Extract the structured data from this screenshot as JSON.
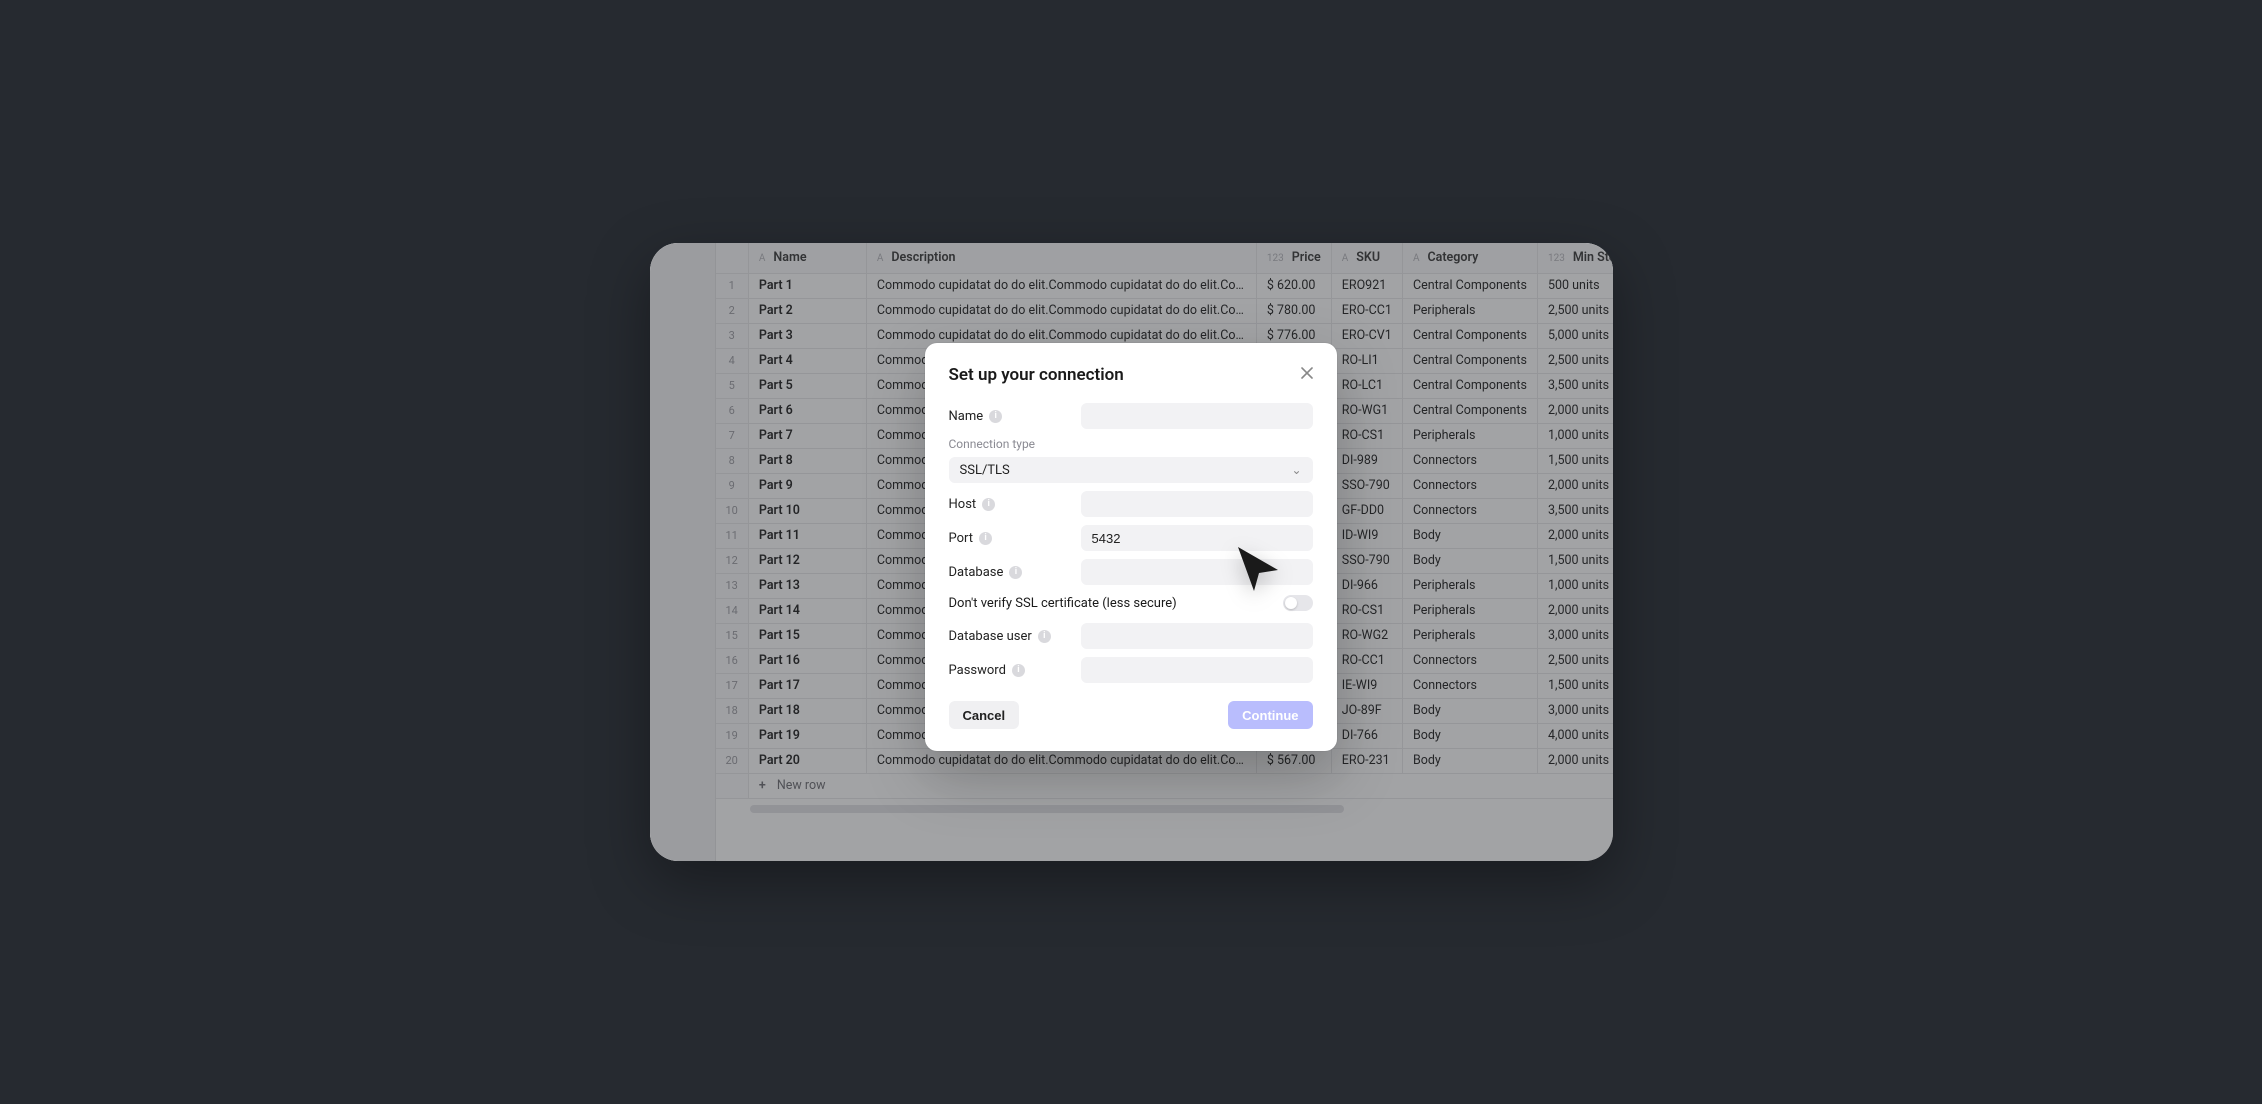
{
  "columns": [
    {
      "icon": "A",
      "label": "Name"
    },
    {
      "icon": "A",
      "label": "Description"
    },
    {
      "icon": "123",
      "label": "Price"
    },
    {
      "icon": "A",
      "label": "SKU"
    },
    {
      "icon": "A",
      "label": "Category"
    },
    {
      "icon": "123",
      "label": "Min Stock Level"
    }
  ],
  "description_filler": "Commodo cupidatat do do elit.Commodo cupidatat do do elit.Commodo cupidat",
  "rows": [
    {
      "name": "Part 1",
      "price": "$ 620.00",
      "sku": "ERO921",
      "cat": "Central Components",
      "stock": "500 units"
    },
    {
      "name": "Part 2",
      "price": "$ 780.00",
      "sku": "ERO-CC1",
      "cat": "Peripherals",
      "stock": "2,500 units"
    },
    {
      "name": "Part 3",
      "price": "$ 776.00",
      "sku": "ERO-CV1",
      "cat": "Central Components",
      "stock": "5,000 units"
    },
    {
      "name": "Part 4",
      "price": "",
      "sku": "RO-LI1",
      "cat": "Central Components",
      "stock": "2,500 units"
    },
    {
      "name": "Part 5",
      "price": "",
      "sku": "RO-LC1",
      "cat": "Central Components",
      "stock": "3,500 units"
    },
    {
      "name": "Part 6",
      "price": "",
      "sku": "RO-WG1",
      "cat": "Central Components",
      "stock": "2,000 units"
    },
    {
      "name": "Part 7",
      "price": "",
      "sku": "RO-CS1",
      "cat": "Peripherals",
      "stock": "1,000 units"
    },
    {
      "name": "Part 8",
      "price": "",
      "sku": "DI-989",
      "cat": "Connectors",
      "stock": "1,500 units"
    },
    {
      "name": "Part 9",
      "price": "",
      "sku": "SSO-790",
      "cat": "Connectors",
      "stock": "2,000 units"
    },
    {
      "name": "Part 10",
      "price": "",
      "sku": "GF-DD0",
      "cat": "Connectors",
      "stock": "3,500 units"
    },
    {
      "name": "Part 11",
      "price": "",
      "sku": "ID-WI9",
      "cat": "Body",
      "stock": "2,000 units"
    },
    {
      "name": "Part 12",
      "price": "",
      "sku": "SSO-790",
      "cat": "Body",
      "stock": "1,500 units"
    },
    {
      "name": "Part 13",
      "price": "",
      "sku": "DI-966",
      "cat": "Peripherals",
      "stock": "1,000 units"
    },
    {
      "name": "Part 14",
      "price": "",
      "sku": "RO-CS1",
      "cat": "Peripherals",
      "stock": "2,000 units"
    },
    {
      "name": "Part 15",
      "price": "",
      "sku": "RO-WG2",
      "cat": "Peripherals",
      "stock": "3,000 units"
    },
    {
      "name": "Part 16",
      "price": "",
      "sku": "RO-CC1",
      "cat": "Connectors",
      "stock": "2,500 units"
    },
    {
      "name": "Part 17",
      "price": "",
      "sku": "IE-WI9",
      "cat": "Connectors",
      "stock": "1,500 units"
    },
    {
      "name": "Part 18",
      "price": "",
      "sku": "JO-89F",
      "cat": "Body",
      "stock": "3,000 units"
    },
    {
      "name": "Part 19",
      "price": "",
      "sku": "DI-766",
      "cat": "Body",
      "stock": "4,000 units"
    },
    {
      "name": "Part 20",
      "price": "$ 567.00",
      "sku": "ERO-231",
      "cat": "Body",
      "stock": "2,000 units"
    }
  ],
  "new_row_label": "New row",
  "modal": {
    "title": "Set up your connection",
    "fields": {
      "name": "Name",
      "connection_type_label": "Connection type",
      "connection_type_value": "SSL/TLS",
      "host": "Host",
      "port_label": "Port",
      "port_value": "5432",
      "database": "Database",
      "ssl_verify": "Don't verify SSL certificate (less secure)",
      "db_user": "Database user",
      "password": "Password"
    },
    "actions": {
      "cancel": "Cancel",
      "continue": "Continue"
    }
  }
}
